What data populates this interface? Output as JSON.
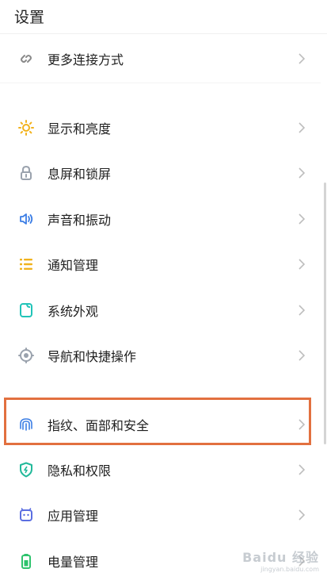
{
  "header": {
    "title": "设置"
  },
  "menu": [
    {
      "label": "更多连接方式",
      "icon": "link-icon",
      "color": "#8a8a8a"
    },
    {
      "label": "显示和亮度",
      "icon": "sun-icon",
      "color": "#f2b21c"
    },
    {
      "label": "息屏和锁屏",
      "icon": "lock-icon",
      "color": "#9aa2ad"
    },
    {
      "label": "声音和振动",
      "icon": "speaker-icon",
      "color": "#3c7ee5"
    },
    {
      "label": "通知管理",
      "icon": "list-icon",
      "color": "#f0b21d"
    },
    {
      "label": "系统外观",
      "icon": "theme-icon",
      "color": "#21c4b8"
    },
    {
      "label": "导航和快捷操作",
      "icon": "target-icon",
      "color": "#9aa2ad"
    },
    {
      "label": "指纹、面部和安全",
      "icon": "fingerprint-icon",
      "color": "#3c7ee5",
      "highlighted": true
    },
    {
      "label": "隐私和权限",
      "icon": "shield-icon",
      "color": "#22b99a"
    },
    {
      "label": "应用管理",
      "icon": "app-icon",
      "color": "#5b6ee1"
    },
    {
      "label": "电量管理",
      "icon": "battery-icon",
      "color": "#2ec36d"
    }
  ],
  "watermark": {
    "brand": "Baidu 经验",
    "sub": "jingyan.baidu.com"
  }
}
